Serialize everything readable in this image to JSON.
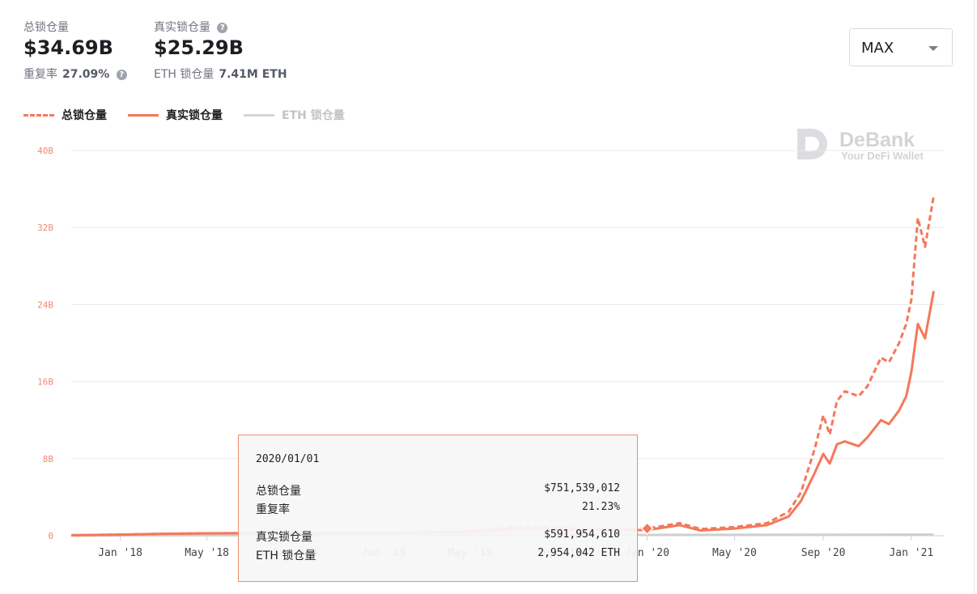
{
  "header": {
    "total_tvl_label": "总锁仓量",
    "total_tvl_value": "$34.69B",
    "overlap_label": "重复率",
    "overlap_value": "27.09%",
    "real_tvl_label": "真实锁仓量",
    "real_tvl_value": "$25.29B",
    "eth_label": "ETH 锁仓量",
    "eth_value": "7.41M ETH",
    "help_glyph": "?"
  },
  "range_select": {
    "value": "MAX"
  },
  "watermark": {
    "brand": "DeBank",
    "tagline": "Your DeFi Wallet"
  },
  "tooltip": {
    "date": "2020/01/01",
    "rows": [
      {
        "label": "总锁仓量",
        "value": "$751,539,012"
      },
      {
        "label": "重复率",
        "value": "21.23%"
      },
      {
        "label": "真实锁仓量",
        "value": "$591,954,610"
      },
      {
        "label": "ETH 锁仓量",
        "value": "2,954,042 ETH"
      }
    ]
  },
  "colors": {
    "accent": "#f4785a",
    "grid": "#e8e8e8",
    "eth": "#cfcfcf",
    "axis_text": "#f08a70"
  },
  "chart_data": {
    "type": "line",
    "y_unit": "B",
    "ylim": [
      0,
      40
    ],
    "y_ticks": [
      0,
      8,
      16,
      24,
      32,
      40
    ],
    "y_tick_labels": [
      "0",
      "8B",
      "16B",
      "24B",
      "32B",
      "40B"
    ],
    "xlim": [
      "2017-10-25",
      "2021-02-15"
    ],
    "x_ticks": [
      {
        "date": "2018-01-01",
        "label": "Jan '18"
      },
      {
        "date": "2018-05-01",
        "label": "May '18"
      },
      {
        "date": "2018-09-01",
        "label": "Sep '18"
      },
      {
        "date": "2019-01-01",
        "label": "Jan '19"
      },
      {
        "date": "2019-05-01",
        "label": "May '19"
      },
      {
        "date": "2019-09-01",
        "label": "Sep '19"
      },
      {
        "date": "2020-01-01",
        "label": "Jan '20"
      },
      {
        "date": "2020-05-01",
        "label": "May '20"
      },
      {
        "date": "2020-09-01",
        "label": "Sep '20"
      },
      {
        "date": "2021-01-01",
        "label": "Jan '21"
      }
    ],
    "grid": true,
    "legend_position": "top-left",
    "highlight": {
      "date": "2020-01-01",
      "value": 0.75
    },
    "series": [
      {
        "name": "总锁仓量",
        "style": "dashed",
        "color": "#f4785a",
        "points": [
          [
            "2017-10-25",
            0.05
          ],
          [
            "2018-01-01",
            0.12
          ],
          [
            "2018-03-01",
            0.2
          ],
          [
            "2018-05-01",
            0.25
          ],
          [
            "2018-08-01",
            0.28
          ],
          [
            "2018-11-01",
            0.27
          ],
          [
            "2019-01-01",
            0.28
          ],
          [
            "2019-05-01",
            0.45
          ],
          [
            "2019-07-01",
            0.9
          ],
          [
            "2019-10-01",
            0.75
          ],
          [
            "2020-01-01",
            0.75
          ],
          [
            "2020-02-15",
            1.3
          ],
          [
            "2020-03-15",
            0.7
          ],
          [
            "2020-05-01",
            0.9
          ],
          [
            "2020-06-15",
            1.3
          ],
          [
            "2020-07-15",
            2.5
          ],
          [
            "2020-08-01",
            4.5
          ],
          [
            "2020-08-20",
            9.0
          ],
          [
            "2020-09-01",
            12.5
          ],
          [
            "2020-09-10",
            10.5
          ],
          [
            "2020-09-20",
            14.0
          ],
          [
            "2020-10-01",
            15.0
          ],
          [
            "2020-10-20",
            14.5
          ],
          [
            "2020-11-01",
            15.5
          ],
          [
            "2020-11-20",
            18.5
          ],
          [
            "2020-12-01",
            18.0
          ],
          [
            "2020-12-15",
            20.0
          ],
          [
            "2020-12-25",
            22.0
          ],
          [
            "2021-01-01",
            24.5
          ],
          [
            "2021-01-10",
            33.0
          ],
          [
            "2021-01-20",
            30.0
          ],
          [
            "2021-02-01",
            35.3
          ]
        ]
      },
      {
        "name": "真实锁仓量",
        "style": "solid",
        "color": "#f4785a",
        "points": [
          [
            "2017-10-25",
            0.05
          ],
          [
            "2018-01-01",
            0.12
          ],
          [
            "2018-03-01",
            0.2
          ],
          [
            "2018-05-01",
            0.25
          ],
          [
            "2018-08-01",
            0.27
          ],
          [
            "2018-11-01",
            0.26
          ],
          [
            "2019-01-01",
            0.27
          ],
          [
            "2019-05-01",
            0.4
          ],
          [
            "2019-07-01",
            0.7
          ],
          [
            "2019-10-01",
            0.62
          ],
          [
            "2020-01-01",
            0.59
          ],
          [
            "2020-02-15",
            1.1
          ],
          [
            "2020-03-15",
            0.55
          ],
          [
            "2020-05-01",
            0.75
          ],
          [
            "2020-06-15",
            1.1
          ],
          [
            "2020-07-15",
            2.0
          ],
          [
            "2020-08-01",
            3.6
          ],
          [
            "2020-08-20",
            6.5
          ],
          [
            "2020-09-01",
            8.5
          ],
          [
            "2020-09-10",
            7.5
          ],
          [
            "2020-09-20",
            9.5
          ],
          [
            "2020-10-01",
            9.8
          ],
          [
            "2020-10-20",
            9.3
          ],
          [
            "2020-11-01",
            10.2
          ],
          [
            "2020-11-20",
            12.0
          ],
          [
            "2020-12-01",
            11.6
          ],
          [
            "2020-12-15",
            13.0
          ],
          [
            "2020-12-25",
            14.5
          ],
          [
            "2021-01-01",
            17.0
          ],
          [
            "2021-01-10",
            22.0
          ],
          [
            "2021-01-20",
            20.5
          ],
          [
            "2021-02-01",
            25.4
          ]
        ]
      },
      {
        "name": "ETH 锁仓量",
        "style": "solid",
        "color": "#cfcfcf",
        "points": [
          [
            "2017-10-25",
            0.02
          ],
          [
            "2018-05-01",
            0.05
          ],
          [
            "2019-01-01",
            0.05
          ],
          [
            "2019-07-01",
            0.08
          ],
          [
            "2020-01-01",
            0.08
          ],
          [
            "2020-08-01",
            0.1
          ],
          [
            "2021-02-01",
            0.12
          ]
        ]
      }
    ]
  }
}
